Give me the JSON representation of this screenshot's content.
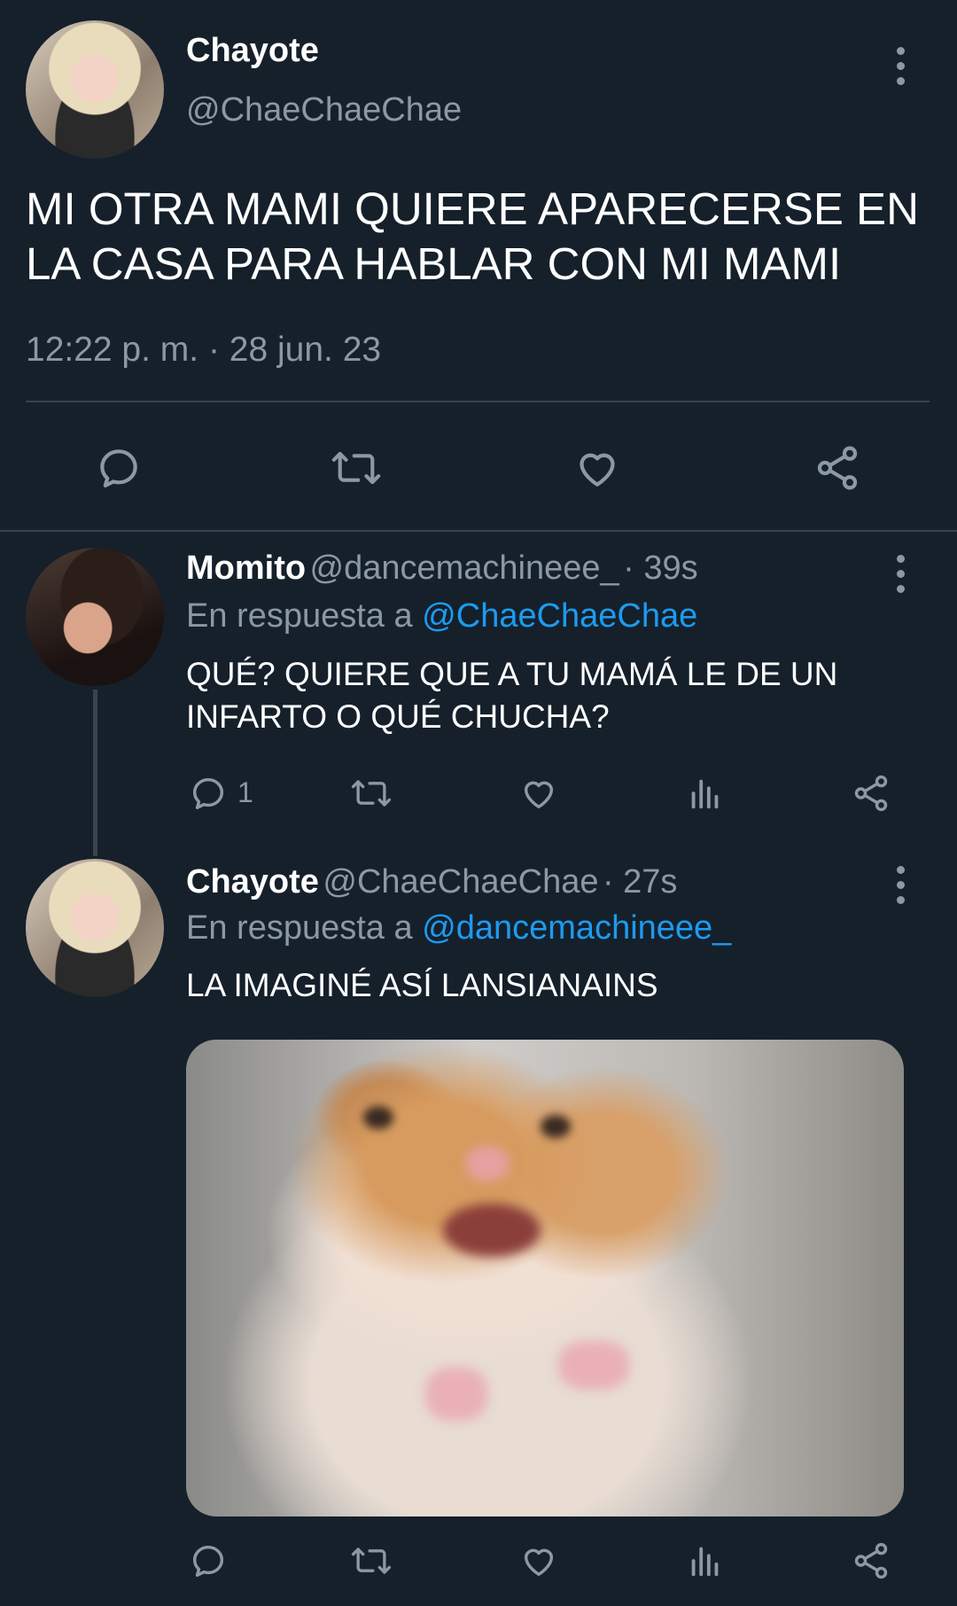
{
  "main_tweet": {
    "name": "Chayote",
    "handle": "@ChaeChaeChae",
    "text_line1": "MI OTRA MAMI QUIERE APARECERSE EN",
    "text_line2": "LA CASA PARA HABLAR CON MI MAMI",
    "timestamp": "12:22 p. m. · 28 jun. 23",
    "actions": {
      "reply_icon": "reply-icon",
      "retweet_icon": "retweet-icon",
      "like_icon": "heart-icon",
      "share_icon": "share-icon"
    }
  },
  "replies": [
    {
      "name": "Momito",
      "handle": "@dancemachineee_",
      "time": "· 39s",
      "replying_prefix": "En respuesta a",
      "replying_to": "@ChaeChaeChae",
      "text_line1": "QUÉ? QUIERE QUE A TU MAMÁ LE DE UN",
      "text_line2": "INFARTO O QUÉ CHUCHA?",
      "reply_count": "1"
    },
    {
      "name": "Chayote",
      "handle": "@ChaeChaeChae",
      "time": "· 27s",
      "replying_prefix": "En respuesta a",
      "replying_to": "@dancemachineee_",
      "text_line1": "LA IMAGINÉ ASÍ LANSIANAINS",
      "media": "hamster-photo"
    }
  ],
  "colors": {
    "background": "#15202b",
    "muted": "#8b98a5",
    "link": "#1d9bf0",
    "divider": "#38444d"
  }
}
